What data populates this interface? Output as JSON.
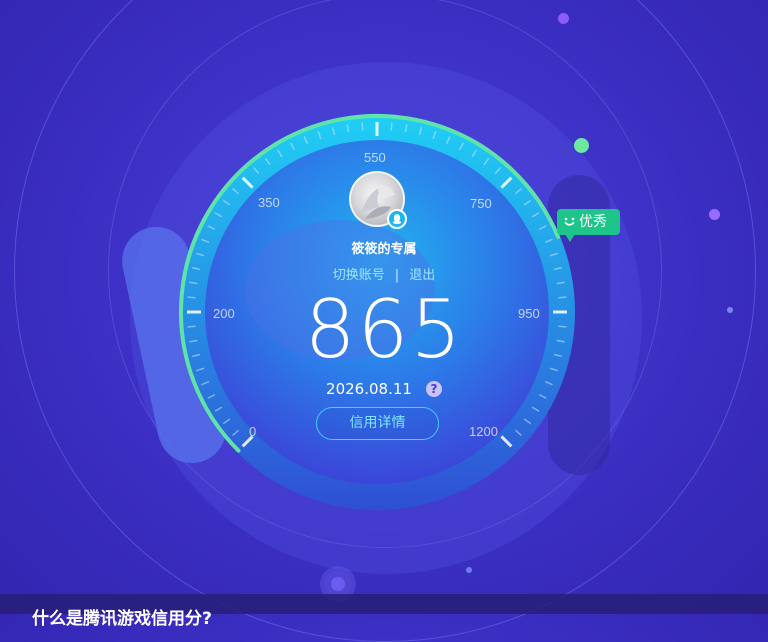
{
  "user": {
    "name": "筱筱的专属",
    "switch_account": "切换账号",
    "separator": "|",
    "logout": "退出"
  },
  "credit": {
    "score": "865",
    "date": "2026.08.11",
    "help": "?",
    "detail_button": "信用详情",
    "level": "优秀",
    "gauge_min": 0,
    "gauge_max": 1200,
    "ticks": [
      "0",
      "200",
      "350",
      "550",
      "750",
      "950",
      "1200"
    ]
  },
  "footer": {
    "question": "什么是腾讯游戏信用分?"
  },
  "colors": {
    "background": "#3b2fc4",
    "accent_cyan": "#3fd0ff",
    "progress_green": "#5fe3a8",
    "level_green": "#1ec58a"
  }
}
